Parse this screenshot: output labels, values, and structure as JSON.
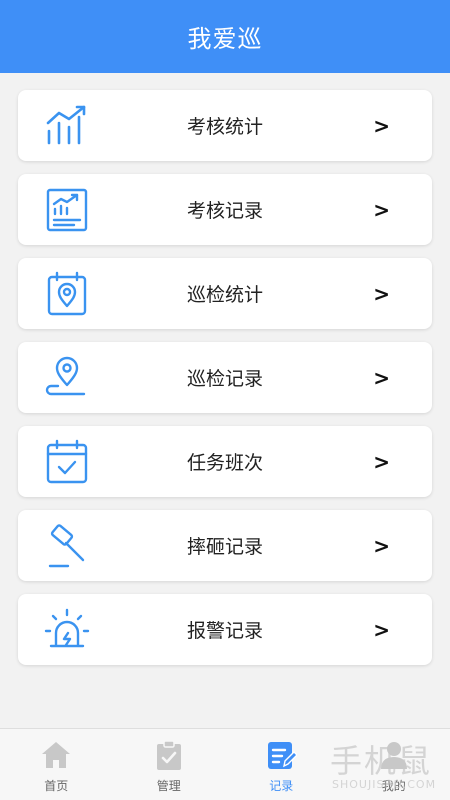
{
  "header": {
    "title": "我爱巡"
  },
  "colors": {
    "accent": "#3f8ff7",
    "icon_blue": "#3a93f0",
    "tab_gray": "#c8c8c8"
  },
  "menu": {
    "items": [
      {
        "label": "考核统计",
        "arrow": ">",
        "icon": "bar-chart-trend-icon"
      },
      {
        "label": "考核记录",
        "arrow": ">",
        "icon": "report-chart-icon"
      },
      {
        "label": "巡检统计",
        "arrow": ">",
        "icon": "calendar-location-icon"
      },
      {
        "label": "巡检记录",
        "arrow": ">",
        "icon": "map-pin-icon"
      },
      {
        "label": "任务班次",
        "arrow": ">",
        "icon": "calendar-check-icon"
      },
      {
        "label": "摔砸记录",
        "arrow": ">",
        "icon": "gavel-icon"
      },
      {
        "label": "报警记录",
        "arrow": ">",
        "icon": "alarm-light-icon"
      }
    ]
  },
  "tabbar": {
    "tabs": [
      {
        "label": "首页",
        "icon": "home-icon",
        "active": false
      },
      {
        "label": "管理",
        "icon": "clipboard-check-icon",
        "active": false
      },
      {
        "label": "记录",
        "icon": "record-edit-icon",
        "active": true
      },
      {
        "label": "我的",
        "icon": "user-icon",
        "active": false
      }
    ]
  },
  "watermark": {
    "text": "手机鼠",
    "sub": "SHOUJISHU.COM"
  }
}
